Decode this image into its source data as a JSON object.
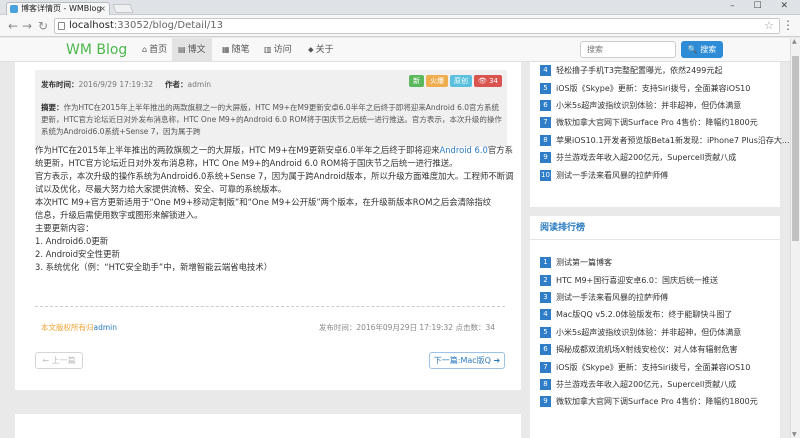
{
  "browser": {
    "tab_title": "博客详情页 - WMBlog",
    "tab_close": "×",
    "window_controls": "– ☐ ✕",
    "back_icon": "←",
    "forward_icon": "→",
    "reload_icon": "↻",
    "url_host": "localhost",
    "url_path": ":33052/blog/Detail/13",
    "star_icon": "☆",
    "menu_icon": "⋮"
  },
  "site_nav": {
    "brand": "WM Blog",
    "items": [
      {
        "icon": "⌂",
        "label": "首页"
      },
      {
        "icon": "▤",
        "label": "博文"
      },
      {
        "icon": "▦",
        "label": "随笔"
      },
      {
        "icon": "▥",
        "label": "访问"
      },
      {
        "icon": "⬥",
        "label": "关于"
      }
    ],
    "search_placeholder": "搜索",
    "search_button": "🔍 搜索"
  },
  "article": {
    "publish_label": "发布时间：",
    "publish_time": "2016/9/29 17:19:32",
    "author_label": "作者：",
    "author": "admin",
    "badges": [
      {
        "text": "新",
        "color": "#5cb85c"
      },
      {
        "text": "火爆",
        "color": "#f0ad4e"
      },
      {
        "text": "原创",
        "color": "#5bc0de"
      },
      {
        "text": "👁 34",
        "color": "#d9534f"
      }
    ],
    "summary_label": "摘要：",
    "summary": "作为HTC在2015年上半年推出的两款旗舰之一的大屏版，HTC M9+在M9更新安卓6.0半年之后终于即将迎来Android 6.0官方系统更新，HTC官方论坛近日对外发布消息称，HTC One M9+的Android 6.0 ROM将于国庆节之后统一进行推送。官方表示，本次升级的操作系统为Android6.0系统+Sense 7，因为属于跨",
    "paragraphs": [
      {
        "pre": "作为HTC在2015年上半年推出的两款旗舰之一的大屏版，HTC M9+在M9更新安卓6.0半年之后终于即将迎来",
        "link": "Android 6.0",
        "post": "官方系"
      },
      {
        "pre": "统更新，HTC官方论坛近日对外发布消息称，HTC One M9+的Android 6.0 ROM将于国庆节之后统一进行推送。",
        "link": "",
        "post": ""
      },
      {
        "pre": "官方表示，本次升级的操作系统为Android6.0系统+Sense 7，因为属于跨Android版本，所以升级方面难度加大。工程师不断调",
        "link": "",
        "post": ""
      },
      {
        "pre": "试以及优化，尽最大努力给大家提供流畅、安全、可靠的系统版本。",
        "link": "",
        "post": ""
      },
      {
        "pre": "本次HTC M9+官方更新适用于“One M9+移动定制版”和“One M9+公开版”两个版本，在升级新版本ROM之后会清除指纹",
        "link": "",
        "post": ""
      },
      {
        "pre": "信息，升级后需使用数字或图形来解锁进入。",
        "link": "",
        "post": ""
      },
      {
        "pre": "主要更新内容：",
        "link": "",
        "post": ""
      },
      {
        "pre": "1. Android6.0更新",
        "link": "",
        "post": ""
      },
      {
        "pre": "2. Android安全性更新",
        "link": "",
        "post": ""
      },
      {
        "pre": "3. 系统优化（例：“HTC安全助手”中，新增智能云端省电技术）",
        "link": "",
        "post": ""
      }
    ],
    "copyright_prefix": "本文版权所有归",
    "copyright_author": "admin",
    "pubinfo": "发布时间：2016年09月29日 17:19:32  点击数：34",
    "prev": "← 上一篇",
    "next": "下一篇:Mac版Q ➔"
  },
  "sidebar": {
    "latest": [
      {
        "num": "4",
        "title": "轻松撸子手机T3完整配置曝光，依然2499元起"
      },
      {
        "num": "5",
        "title": "iOS版《Skype》更新：支持Siri拨号，全面兼容iOS10"
      },
      {
        "num": "6",
        "title": "小米5s超声波指纹识别体验：并非超神，但仍体满意"
      },
      {
        "num": "7",
        "title": "微软加拿大官网下调Surface Pro 4售价：降幅约1800元"
      },
      {
        "num": "8",
        "title": "苹果iOS10.1开发者预览版Beta1新发现：iPhone7 Plus沿存大..."
      },
      {
        "num": "9",
        "title": "芬兰游戏去年收入超200亿元，Supercell贡献八成"
      },
      {
        "num": "10",
        "title": "测试一手法来看风暴的拉萨师傅"
      }
    ],
    "read_title": "阅读排行榜",
    "read": [
      {
        "num": "1",
        "title": "测试第一篇博客"
      },
      {
        "num": "2",
        "title": "HTC M9+国行喜迎安卓6.0：国庆后统一推送"
      },
      {
        "num": "3",
        "title": "测试一手法来看风暴的拉萨师傅"
      },
      {
        "num": "4",
        "title": "Mac版QQ v5.2.0体验版发布：终于能聊快斗图了"
      },
      {
        "num": "5",
        "title": "小米5s超声波指纹识别体验：并非超神，但仍体满意"
      },
      {
        "num": "6",
        "title": "揭秘成都双流机场X射线安检仪：对人体有辐射危害"
      },
      {
        "num": "7",
        "title": "iOS版《Skype》更新：支持Siri拨号，全面兼容iOS10"
      },
      {
        "num": "8",
        "title": "芬兰游戏去年收入超200亿元，Supercell贡献八成"
      },
      {
        "num": "9",
        "title": "微软加拿大官网下调Surface Pro 4售价：降幅约1800元"
      }
    ]
  }
}
